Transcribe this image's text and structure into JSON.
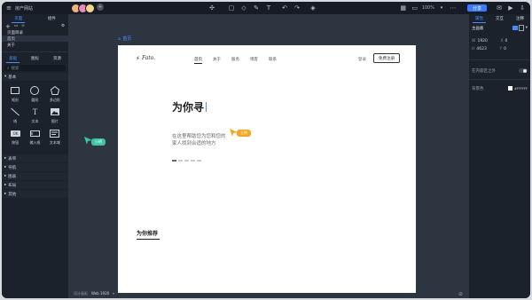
{
  "window": {
    "title": "房产网站"
  },
  "toolbar": {
    "zoom": "100%",
    "share_label": "分享"
  },
  "left_panel": {
    "top_tabs": [
      "页面",
      "组件"
    ],
    "pages": [
      "页面目录",
      "首页",
      "关于"
    ],
    "lib_tabs": [
      "基础",
      "图标",
      "资源"
    ],
    "search_placeholder": "搜索",
    "category": "基本",
    "tools": [
      {
        "icon": "rect-icon",
        "label": "矩形"
      },
      {
        "icon": "ellipse-icon",
        "label": "圆形"
      },
      {
        "icon": "polygon-icon",
        "label": "多边形"
      },
      {
        "icon": "line-icon",
        "label": "线"
      },
      {
        "icon": "text-icon",
        "label": "文本"
      },
      {
        "icon": "image-icon",
        "label": "图片"
      },
      {
        "icon": "button-icon",
        "label": "按钮"
      },
      {
        "icon": "input-icon",
        "label": "输入框"
      },
      {
        "icon": "textarea-icon",
        "label": "文本域"
      }
    ],
    "more_categories": [
      "表单",
      "导航",
      "图表",
      "布局",
      "其他"
    ]
  },
  "canvas": {
    "page_label": "首页",
    "remote_cursor_label": "小明",
    "bottom_left": "设计画板",
    "bottom_size": "Web 1920",
    "site": {
      "logo": "Fato.",
      "nav": [
        "首页",
        "关于",
        "服务",
        "博客",
        "联系"
      ],
      "login": "登录",
      "register": "免费注册",
      "hero_title": "为你寻",
      "hero_sub_line1": "在这里帮助您为您和您的",
      "hero_sub_line2": "家人找到合适的地方",
      "collab_cursor_label": "王明",
      "section_title": "为你推荐"
    }
  },
  "right_panel": {
    "tabs": [
      "属性",
      "交互",
      "注释"
    ],
    "section": "主画板",
    "w_label": "W",
    "w_value": "1920",
    "x_label": "X",
    "x_value": "0",
    "h_label": "H",
    "h_value": "4623",
    "y_label": "Y",
    "y_value": "0",
    "toggle_label": "在内容区之外",
    "bg_label": "背景色",
    "bg_value": "#FFFFFF"
  }
}
